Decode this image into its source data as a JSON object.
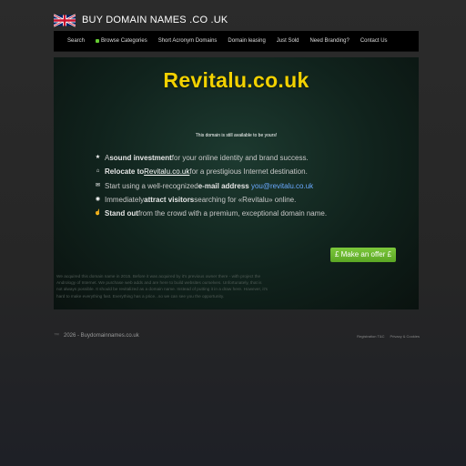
{
  "header": {
    "title": "BUY DOMAIN NAMES .CO .UK",
    "flag_icon": "uk-flag-icon"
  },
  "nav": {
    "items": [
      {
        "label": "Search"
      },
      {
        "label": "Browse Categories",
        "icon": "leaf-icon"
      },
      {
        "label": "Short Acronym Domains"
      },
      {
        "label": "Domain leasing"
      },
      {
        "label": "Just Sold"
      },
      {
        "label": "Need Branding?"
      },
      {
        "label": "Contact Us"
      }
    ]
  },
  "main": {
    "domain": "Revitalu.co.uk",
    "available": "This domain is still available to be yours!",
    "features": [
      {
        "icon": "star-icon",
        "pre": "A ",
        "bold": "sound investment",
        "post": " for your online identity and brand success."
      },
      {
        "icon": "home-icon",
        "bold": "Relocate to ",
        "link": "Revitalu.co.uk",
        "post": " for a prestigious Internet destination."
      },
      {
        "icon": "mail-icon",
        "pre": "Start using a well-recognized ",
        "bold": "e-mail address",
        "email": "you@revitalu.co.uk"
      },
      {
        "icon": "eye-icon",
        "pre": "Immediately ",
        "bold": "attract visitors",
        "post": " searching for «Revitalu» online."
      },
      {
        "icon": "thumbs-up-icon",
        "bold": "Stand out",
        "post": " from the crowd with a premium, exceptional domain name."
      }
    ],
    "offer_button": "£ Make an offer £",
    "description": "We acquired this domain name in 2015. Before it was acquired by it's previous owner there - with project the Andrology of Internet. We purchase web adds and are here to build websites ourselves. Unfortunately, that is not always possible. It should be revitalized as a domain name. Instead of putting it in a draw here. However, it's hard to make everything fast. Everything has a price...so we can see you the opportunity."
  },
  "footer": {
    "copyright": "2026 - Buydomainnames.co.uk",
    "trademark": "™",
    "links": [
      "Registration T&C",
      "Privacy & Cookies"
    ]
  },
  "colors": {
    "domain": "#f2d100",
    "button": "#6dbb30",
    "link": "#6aa9ff",
    "nav_bg": "#000000"
  }
}
